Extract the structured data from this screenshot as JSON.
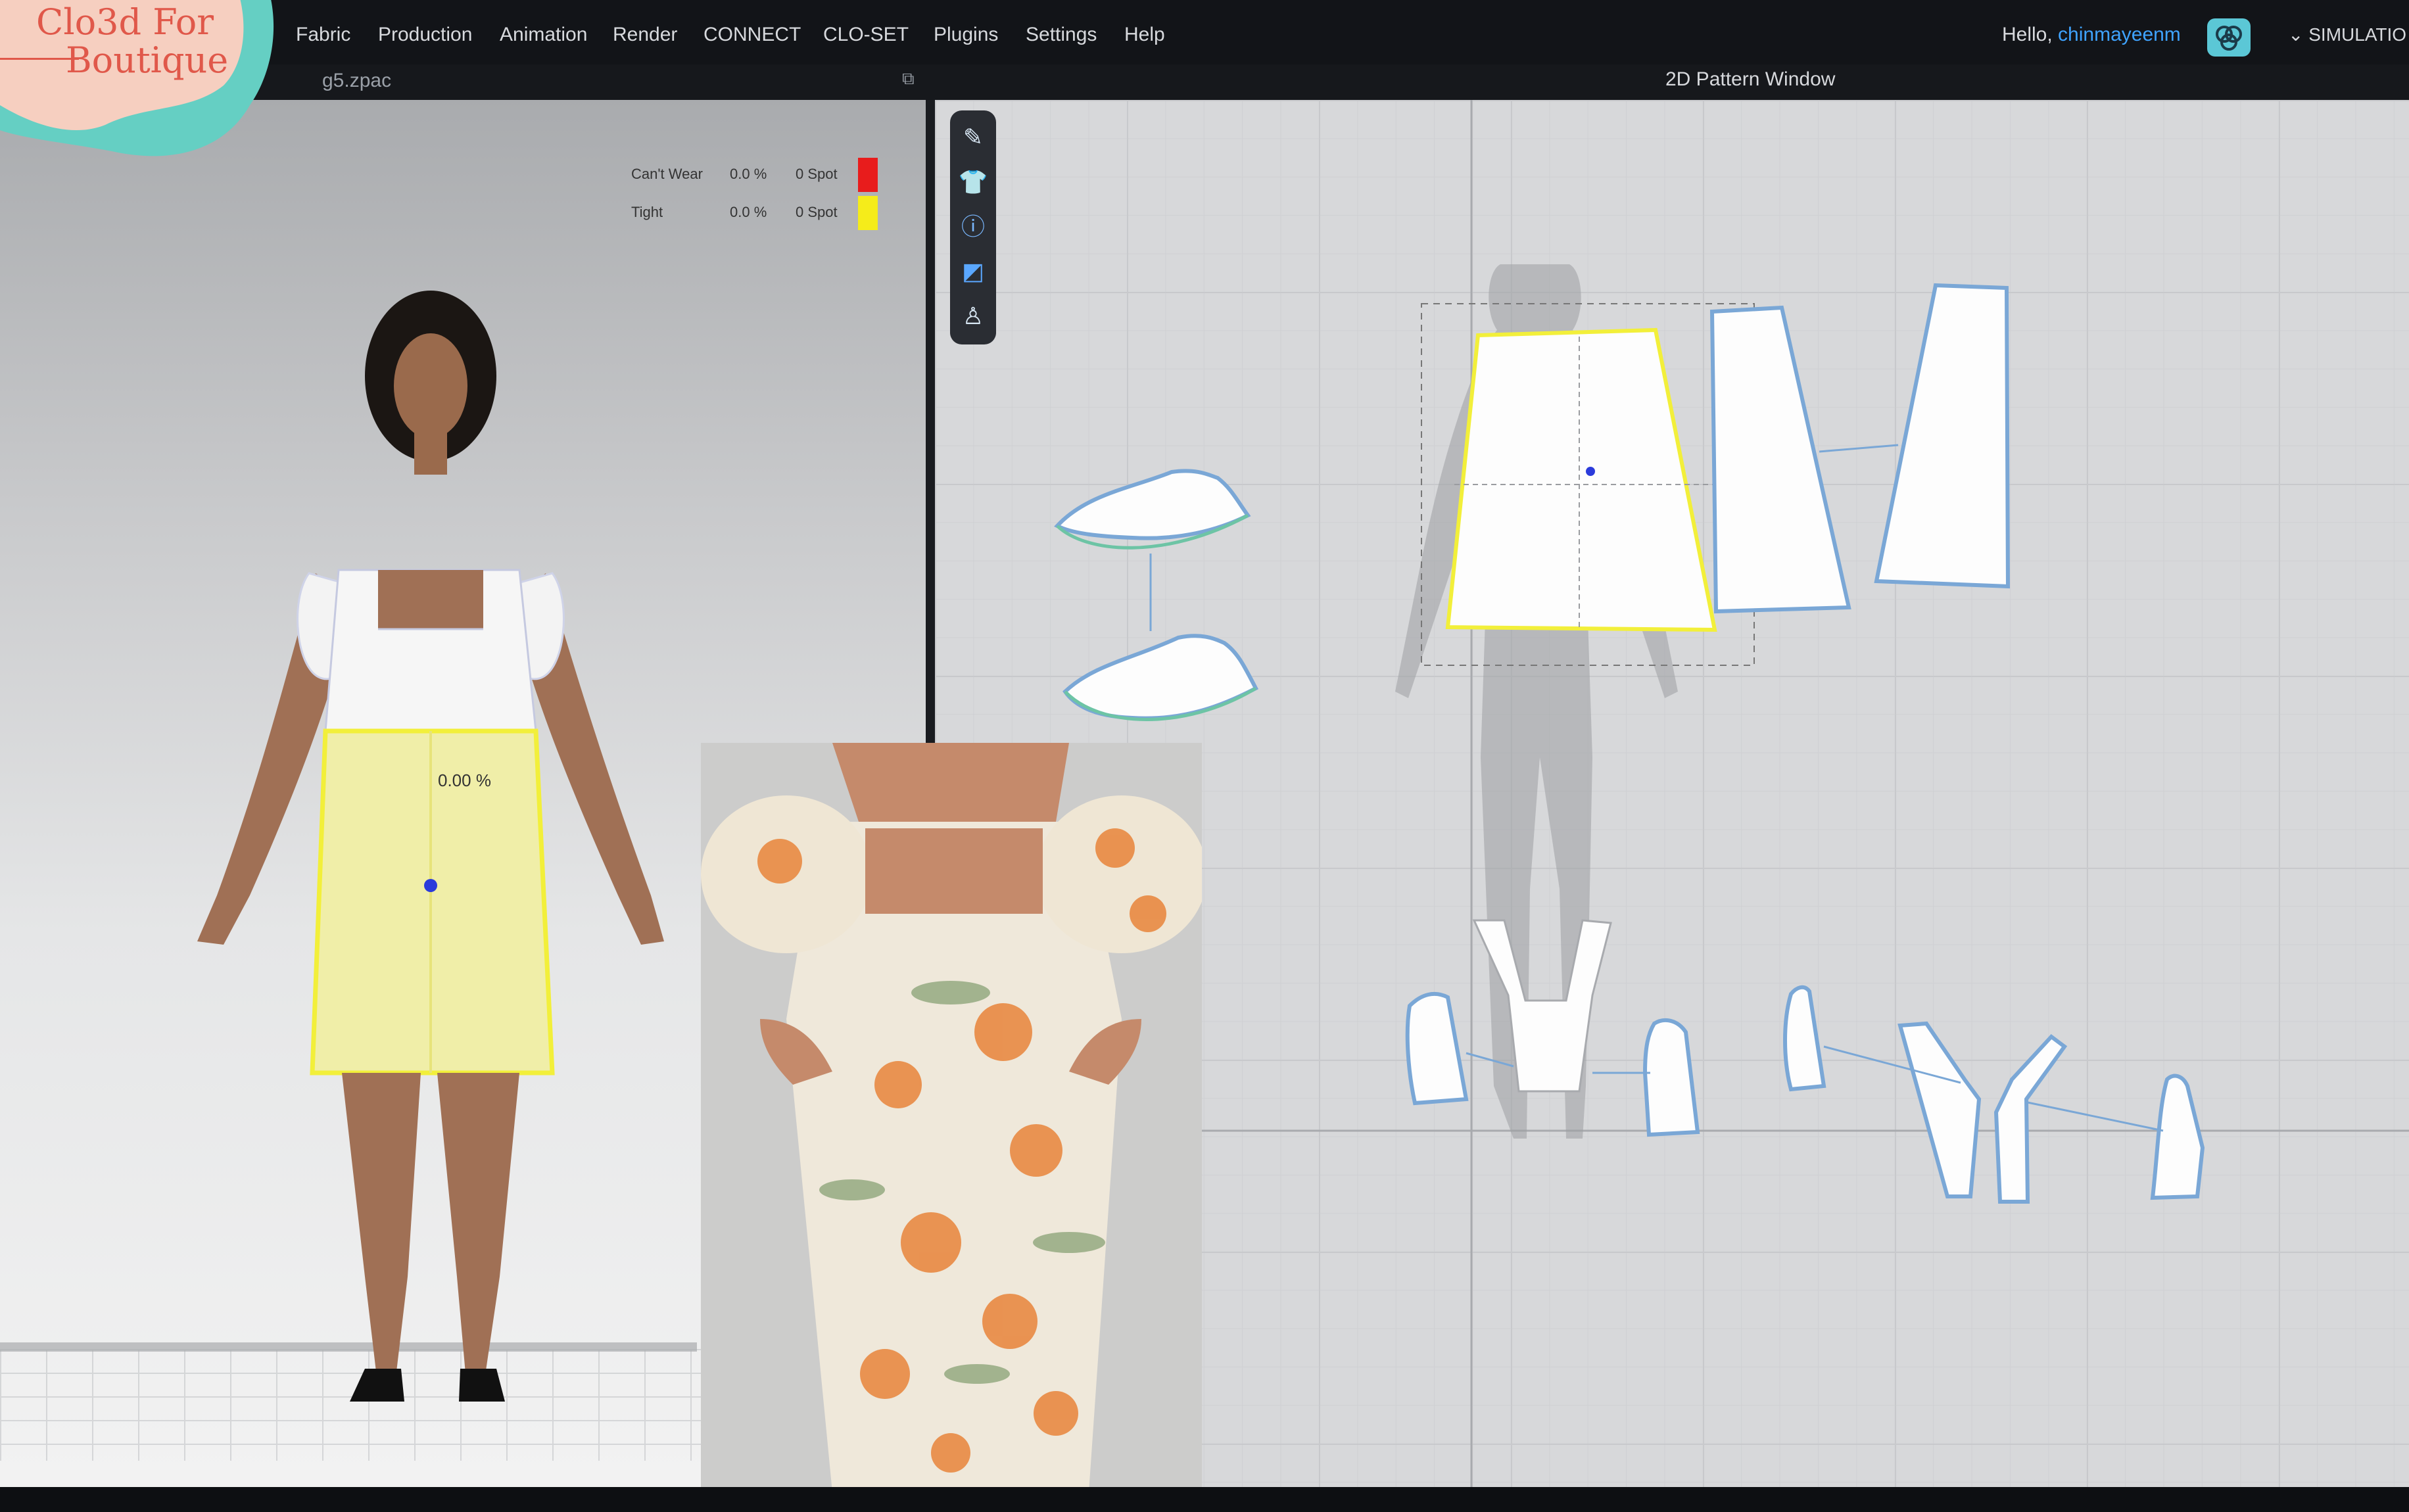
{
  "brand": {
    "line1": "Clo3d For",
    "line2": "Boutique"
  },
  "menu": {
    "items": [
      "Fabric",
      "Production",
      "Animation",
      "Render",
      "CONNECT",
      "CLO-SET",
      "Plugins",
      "Settings",
      "Help"
    ],
    "greeting": "Hello, ",
    "username": "chinmayeenm",
    "sim_label": "SIMULATIO"
  },
  "viewport3d": {
    "file_name": "g5.zpac",
    "legend": [
      {
        "label": "Can't Wear",
        "pct": "0.0 %",
        "spot": "0 Spot",
        "color": "#e81c1c"
      },
      {
        "label": "Tight",
        "pct": "0.0 %",
        "spot": "0 Spot",
        "color": "#f5ec1a"
      }
    ],
    "fit_value": "0.00 %"
  },
  "pattern_window": {
    "title": "2D Pattern Window"
  },
  "toolbar_icons": [
    "pencil-icon",
    "shirt-icon",
    "info-icon",
    "fabric-icon",
    "avatar-shirt-icon"
  ],
  "colors": {
    "accent": "#3fa3ff",
    "selection": "#f2ef3a",
    "piece_outline": "#7aa7d6",
    "brand": "#e0584a",
    "badge": "#65cfc3"
  }
}
